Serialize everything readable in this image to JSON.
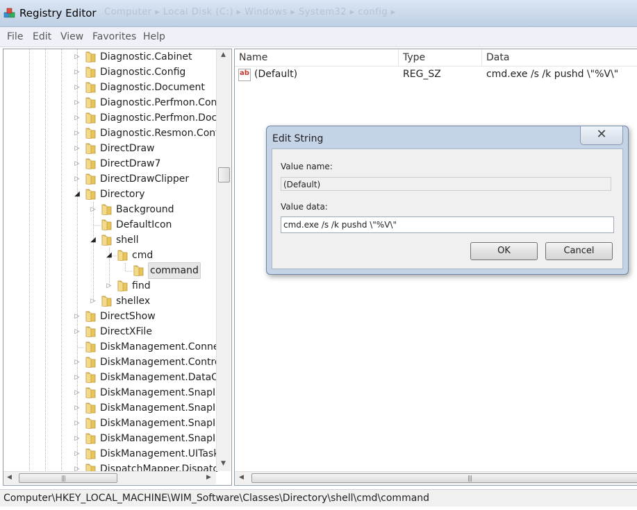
{
  "window": {
    "title": "Registry Editor",
    "title_ghost": "Computer  ▸  Local Disk (C:)  ▸  Windows  ▸  System32  ▸  config  ▸"
  },
  "menu": [
    "File",
    "Edit",
    "View",
    "Favorites",
    "Help"
  ],
  "tree": {
    "items": [
      {
        "label": "Diagnostic.Cabinet",
        "depth": 0,
        "state": "collapsed"
      },
      {
        "label": "Diagnostic.Config",
        "depth": 0,
        "state": "collapsed"
      },
      {
        "label": "Diagnostic.Document",
        "depth": 0,
        "state": "collapsed"
      },
      {
        "label": "Diagnostic.Perfmon.Conf",
        "depth": 0,
        "state": "collapsed"
      },
      {
        "label": "Diagnostic.Perfmon.Docu",
        "depth": 0,
        "state": "collapsed"
      },
      {
        "label": "Diagnostic.Resmon.Conf",
        "depth": 0,
        "state": "collapsed"
      },
      {
        "label": "DirectDraw",
        "depth": 0,
        "state": "collapsed"
      },
      {
        "label": "DirectDraw7",
        "depth": 0,
        "state": "collapsed"
      },
      {
        "label": "DirectDrawClipper",
        "depth": 0,
        "state": "collapsed"
      },
      {
        "label": "Directory",
        "depth": 0,
        "state": "expanded"
      },
      {
        "label": "Background",
        "depth": 1,
        "state": "collapsed"
      },
      {
        "label": "DefaultIcon",
        "depth": 1,
        "state": "leaf"
      },
      {
        "label": "shell",
        "depth": 1,
        "state": "expanded"
      },
      {
        "label": "cmd",
        "depth": 2,
        "state": "expanded"
      },
      {
        "label": "command",
        "depth": 3,
        "state": "leaf",
        "selected": true
      },
      {
        "label": "find",
        "depth": 2,
        "state": "collapsed"
      },
      {
        "label": "shellex",
        "depth": 1,
        "state": "collapsed"
      },
      {
        "label": "DirectShow",
        "depth": 0,
        "state": "collapsed"
      },
      {
        "label": "DirectXFile",
        "depth": 0,
        "state": "collapsed"
      },
      {
        "label": "DiskManagement.Conne",
        "depth": 0,
        "state": "leaf"
      },
      {
        "label": "DiskManagement.Contro",
        "depth": 0,
        "state": "collapsed"
      },
      {
        "label": "DiskManagement.DataO",
        "depth": 0,
        "state": "collapsed"
      },
      {
        "label": "DiskManagement.SnapIn",
        "depth": 0,
        "state": "collapsed"
      },
      {
        "label": "DiskManagement.SnapIn",
        "depth": 0,
        "state": "collapsed"
      },
      {
        "label": "DiskManagement.SnapIn",
        "depth": 0,
        "state": "collapsed"
      },
      {
        "label": "DiskManagement.SnapIn",
        "depth": 0,
        "state": "collapsed"
      },
      {
        "label": "DiskManagement.UITask",
        "depth": 0,
        "state": "collapsed"
      },
      {
        "label": "DispatchMapper.Dispatc",
        "depth": 0,
        "state": "collapsed"
      }
    ]
  },
  "list": {
    "columns": [
      "Name",
      "Type",
      "Data"
    ],
    "rows": [
      {
        "name": "(Default)",
        "type": "REG_SZ",
        "data": "cmd.exe /s /k pushd \\\"%V\\\"",
        "icon": "string-value-icon"
      }
    ]
  },
  "status": {
    "path": "Computer\\HKEY_LOCAL_MACHINE\\WIM_Software\\Classes\\Directory\\shell\\cmd\\command"
  },
  "dialog": {
    "title": "Edit String",
    "value_name_label": "Value name:",
    "value_name": "(Default)",
    "value_data_label": "Value data:",
    "value_data": "cmd.exe /s /k pushd \\\"%V\\\"",
    "ok_label": "OK",
    "cancel_label": "Cancel",
    "close_glyph": "✕"
  },
  "colors": {
    "folder": "#e8c45a",
    "titlebar": "#c9d8ea",
    "dialog_frame": "#c4d3e6"
  }
}
